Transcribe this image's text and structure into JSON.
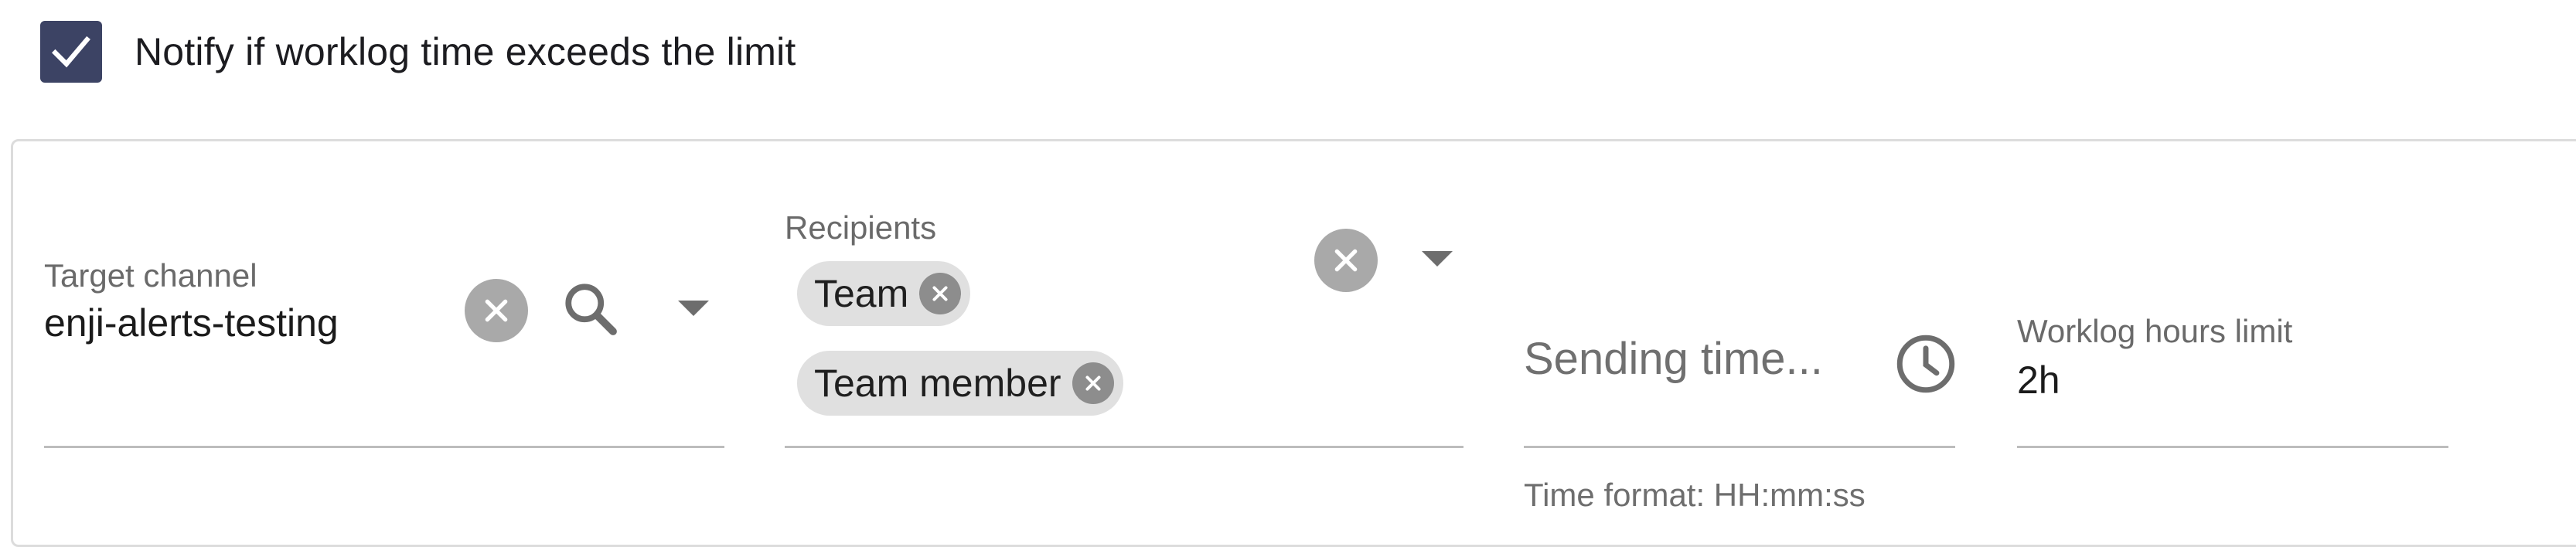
{
  "notify": {
    "checked": true,
    "label": "Notify if worklog time exceeds the limit"
  },
  "target_channel": {
    "label": "Target channel",
    "value": "enji-alerts-testing",
    "icons": [
      "clear-icon",
      "search-icon",
      "dropdown-arrow-icon"
    ]
  },
  "recipients": {
    "label": "Recipients",
    "chips": [
      {
        "label": "Team"
      },
      {
        "label": "Team member"
      }
    ],
    "icons": [
      "clear-icon",
      "dropdown-arrow-icon"
    ]
  },
  "sending_time": {
    "placeholder": "Sending time...",
    "helper": "Time format: HH:mm:ss",
    "icon": "clock-icon"
  },
  "worklog_limit": {
    "label": "Worklog hours limit",
    "value": "2h"
  },
  "colors": {
    "checkbox_bg": "#3c4364",
    "clear_button": "#a9a9a9",
    "chip_bg": "#e0e0e0",
    "underline": "#bdbdbd",
    "card_border": "#dcdcdc"
  }
}
